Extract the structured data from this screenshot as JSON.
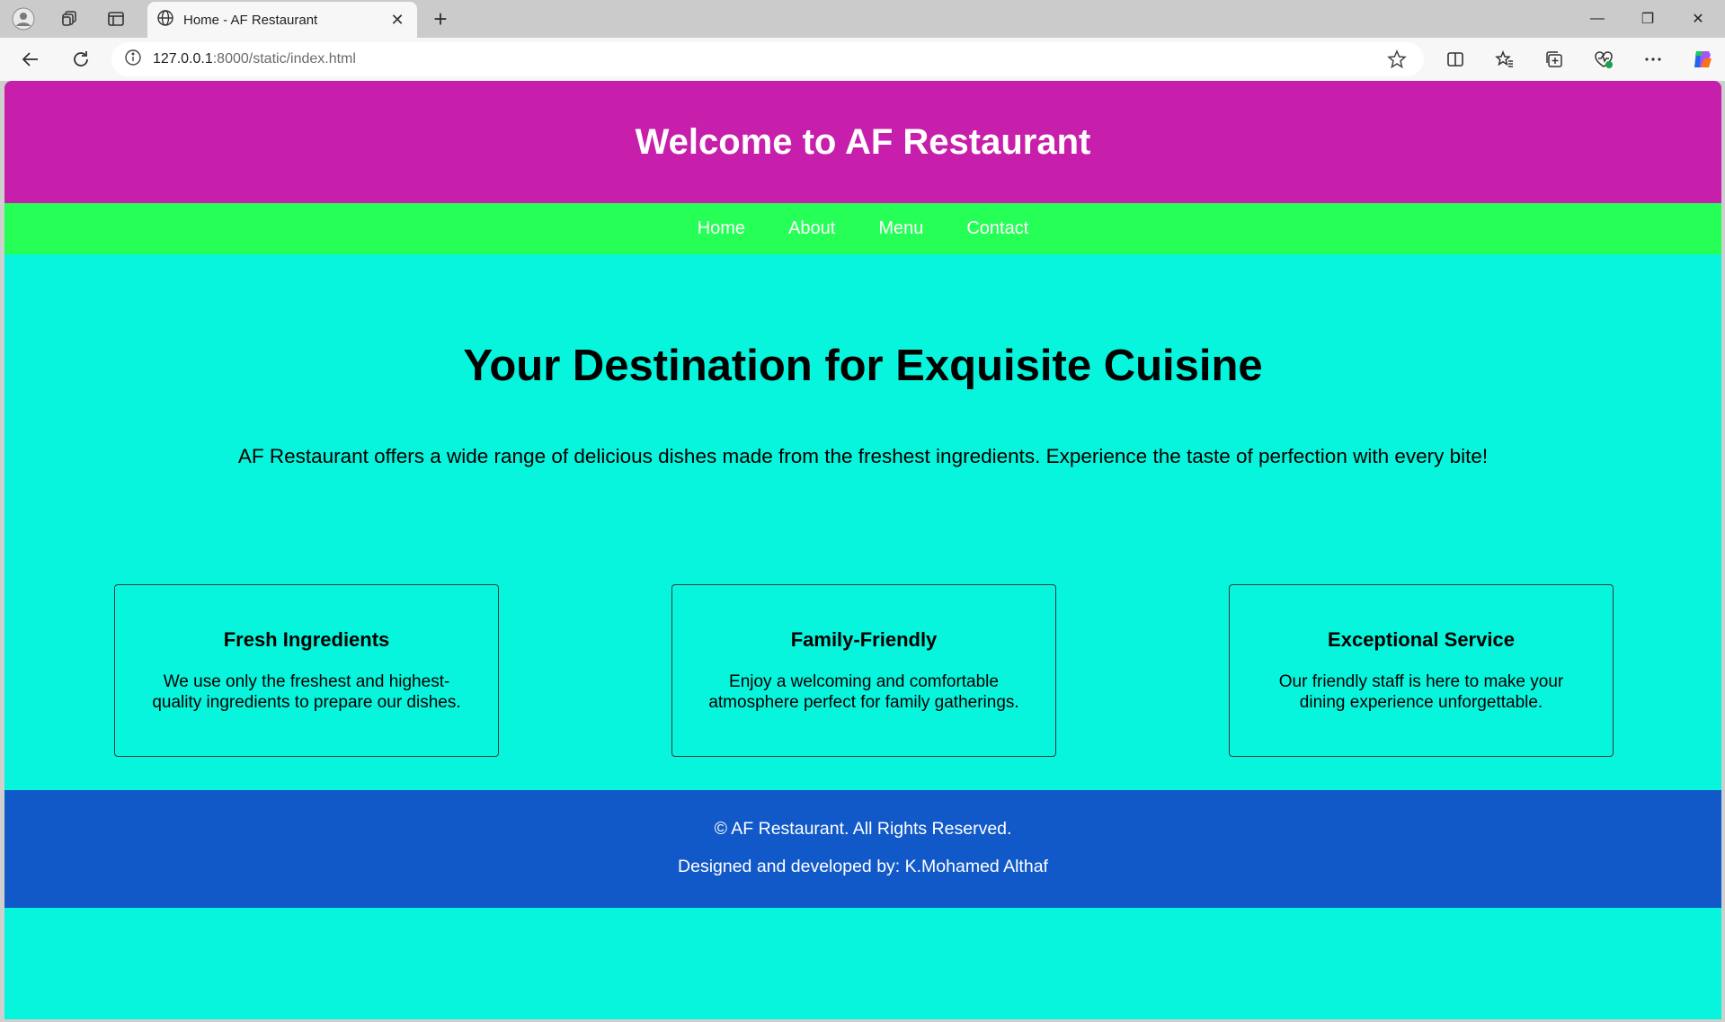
{
  "browser": {
    "tab_title": "Home - AF Restaurant",
    "tab_close": "✕",
    "new_tab": "+",
    "url_host": "127.0.0.1",
    "url_rest": ":8000/static/index.html",
    "window_minimize": "—",
    "window_restore": "❐",
    "window_close": "✕"
  },
  "header": {
    "title": "Welcome to AF Restaurant"
  },
  "nav": {
    "items": [
      "Home",
      "About",
      "Menu",
      "Contact"
    ]
  },
  "hero": {
    "heading": "Your Destination for Exquisite Cuisine",
    "text": "AF Restaurant offers a wide range of delicious dishes made from the freshest ingredients. Experience the taste of perfection with every bite!"
  },
  "features": [
    {
      "title": "Fresh Ingredients",
      "text": "We use only the freshest and highest-quality ingredients to prepare our dishes."
    },
    {
      "title": "Family-Friendly",
      "text": "Enjoy a welcoming and comfortable atmosphere perfect for family gatherings."
    },
    {
      "title": "Exceptional Service",
      "text": "Our friendly staff is here to make your dining experience unforgettable."
    }
  ],
  "footer": {
    "copyright": "© AF Restaurant. All Rights Reserved.",
    "credit": "Designed and developed by: K.Mohamed Althaf"
  },
  "colors": {
    "header_bg": "#c71fab",
    "nav_bg": "#26ff55",
    "page_bg": "#07f5dd",
    "footer_bg": "#1159c8"
  }
}
